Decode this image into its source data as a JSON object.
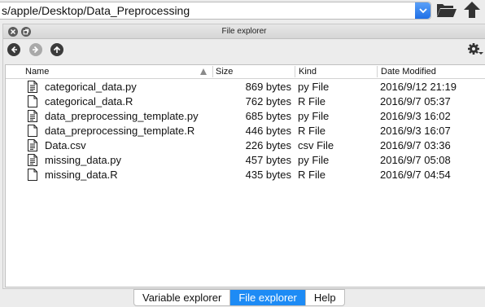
{
  "path": {
    "value": "s/apple/Desktop/Data_Preprocessing",
    "dropdown_icon": "chevron-down-icon",
    "browse_icon": "folder-open-icon",
    "parent_icon": "arrow-up-icon"
  },
  "pane": {
    "title": "File explorer",
    "close_icon": "close-icon",
    "undock_icon": "undock-icon",
    "nav": {
      "back_icon": "arrow-left-icon",
      "forward_icon": "arrow-right-icon",
      "up_icon": "arrow-up-icon",
      "options_icon": "gear-icon"
    }
  },
  "table": {
    "columns": [
      "Name",
      "Size",
      "Kind",
      "Date Modified"
    ],
    "rows": [
      {
        "name": "categorical_data.py",
        "size": "869 bytes",
        "kind": "py File",
        "date": "2016/9/12 21:19",
        "icon": "code-file-icon"
      },
      {
        "name": "categorical_data.R",
        "size": "762 bytes",
        "kind": "R File",
        "date": "2016/9/7 05:37",
        "icon": "file-icon"
      },
      {
        "name": "data_preprocessing_template.py",
        "size": "685 bytes",
        "kind": "py File",
        "date": "2016/9/3 16:02",
        "icon": "code-file-icon"
      },
      {
        "name": "data_preprocessing_template.R",
        "size": "446 bytes",
        "kind": "R File",
        "date": "2016/9/3 16:07",
        "icon": "file-icon"
      },
      {
        "name": "Data.csv",
        "size": "226 bytes",
        "kind": "csv File",
        "date": "2016/9/7 03:36",
        "icon": "code-file-icon"
      },
      {
        "name": "missing_data.py",
        "size": "457 bytes",
        "kind": "py File",
        "date": "2016/9/7 05:08",
        "icon": "code-file-icon"
      },
      {
        "name": "missing_data.R",
        "size": "435 bytes",
        "kind": "R File",
        "date": "2016/9/7 04:54",
        "icon": "file-icon"
      }
    ]
  },
  "tabs": [
    {
      "label": "Variable explorer",
      "active": false
    },
    {
      "label": "File explorer",
      "active": true
    },
    {
      "label": "Help",
      "active": false
    }
  ],
  "colors": {
    "accent": "#1d8bf5",
    "dropdown": "#2a7cf0"
  }
}
